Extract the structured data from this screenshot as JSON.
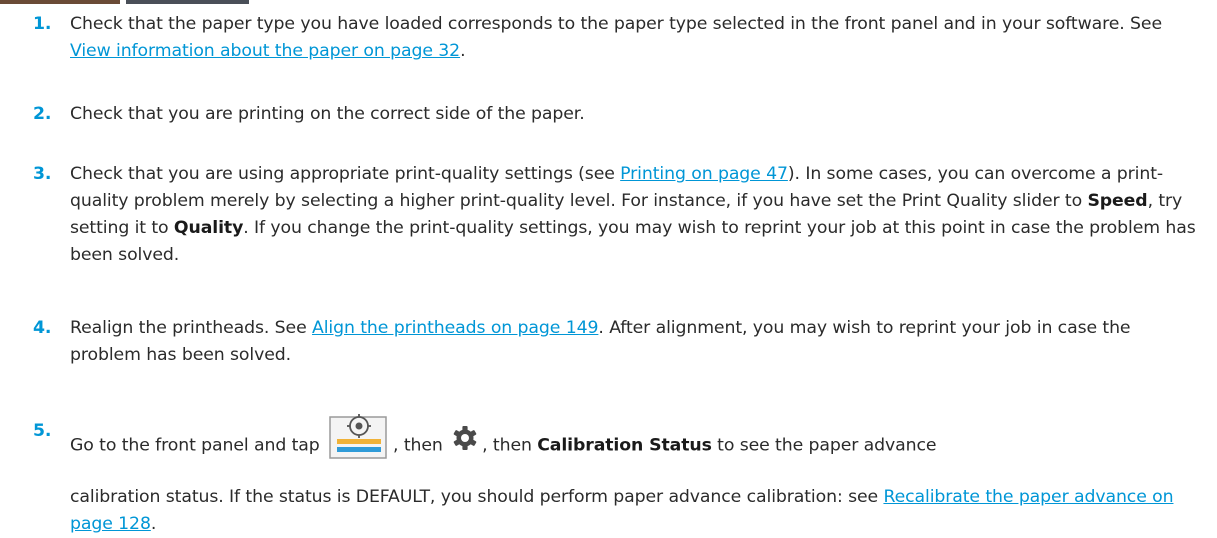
{
  "steps": [
    {
      "number": "1.",
      "t1": "Check that the paper type you have loaded corresponds to the paper type selected in the front panel and in your software. See ",
      "link": "View information about the paper on page 32",
      "t2": "."
    },
    {
      "number": "2.",
      "t1": "Check that you are printing on the correct side of the paper."
    },
    {
      "number": "3.",
      "t1": "Check that you are using appropriate print-quality settings (see ",
      "link": "Printing on page 47",
      "t2": "). In some cases, you can overcome a print-quality problem merely by selecting a higher print-quality level. For instance, if you have set the Print Quality slider to ",
      "bold1": "Speed",
      "t3": ", try setting it to ",
      "bold2": "Quality",
      "t4": ". If you change the print-quality settings, you may wish to reprint your job at this point in case the problem has been solved."
    },
    {
      "number": "4.",
      "t1": "Realign the printheads. See ",
      "link": "Align the printheads on page 149",
      "t2": ". After alignment, you may wish to reprint your job in case the problem has been solved."
    },
    {
      "number": "5.",
      "t1": "Go to the front panel and tap ",
      "icon1": "paper-panel-icon",
      "t2": ", then ",
      "icon2": "gear-icon",
      "t3": ", then ",
      "bold1": "Calibration Status",
      "t4": " to see the paper advance",
      "t5": "calibration status. If the status is DEFAULT, you should perform paper advance calibration: see ",
      "link": "Recalibrate the paper advance on page 128",
      "t6": "."
    }
  ],
  "colors": {
    "accent": "#0096d6",
    "text": "#2b2b2b"
  }
}
